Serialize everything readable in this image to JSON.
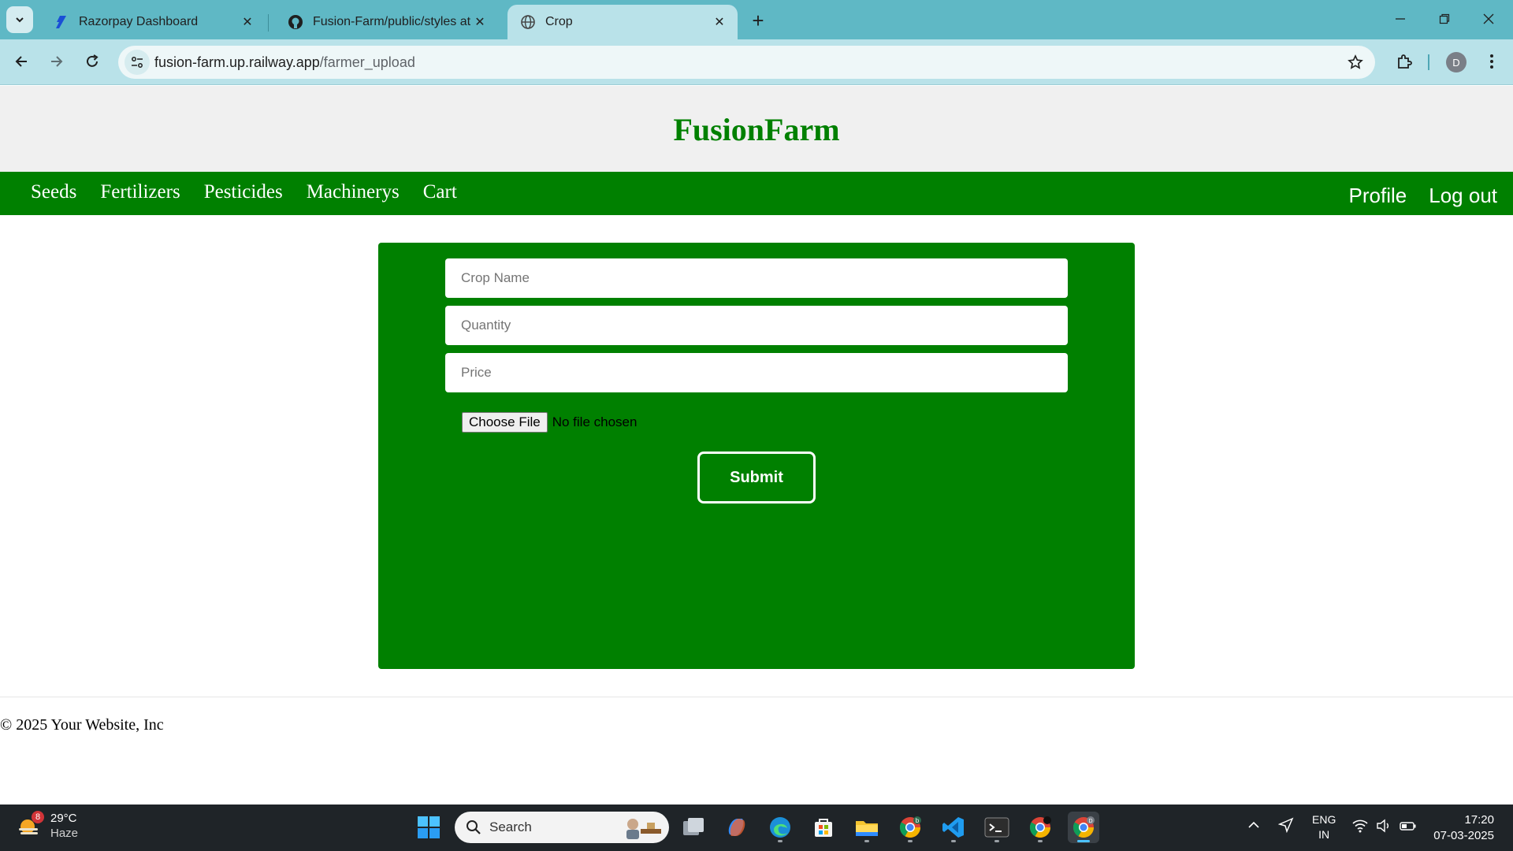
{
  "browser": {
    "tabs": [
      {
        "title": "Razorpay Dashboard",
        "icon": "razorpay-icon",
        "active": false
      },
      {
        "title": "Fusion-Farm/public/styles at m",
        "icon": "github-icon",
        "active": false
      },
      {
        "title": "Crop",
        "icon": "globe-icon",
        "active": true
      }
    ],
    "url_host": "fusion-farm.up.railway.app",
    "url_path": "/farmer_upload",
    "profile_initial": "D"
  },
  "site": {
    "brand": "FusionFarm",
    "nav_left": [
      "Seeds",
      "Fertilizers",
      "Pesticides",
      "Machinerys",
      "Cart"
    ],
    "nav_right": [
      "Profile",
      "Log out"
    ],
    "colors": {
      "primary": "#008000",
      "header_bg": "#f0f0f0"
    }
  },
  "form": {
    "crop_name_placeholder": "Crop Name",
    "quantity_placeholder": "Quantity",
    "price_placeholder": "Price",
    "file_button": "Choose File",
    "file_status": "No file chosen",
    "submit_label": "Submit"
  },
  "footer": {
    "text": "© 2025 Your Website, Inc"
  },
  "taskbar": {
    "weather_temp": "29°C",
    "weather_desc": "Haze",
    "weather_badge": "8",
    "search_label": "Search",
    "lang_line1": "ENG",
    "lang_line2": "IN",
    "time": "17:20",
    "date": "07-03-2025"
  }
}
